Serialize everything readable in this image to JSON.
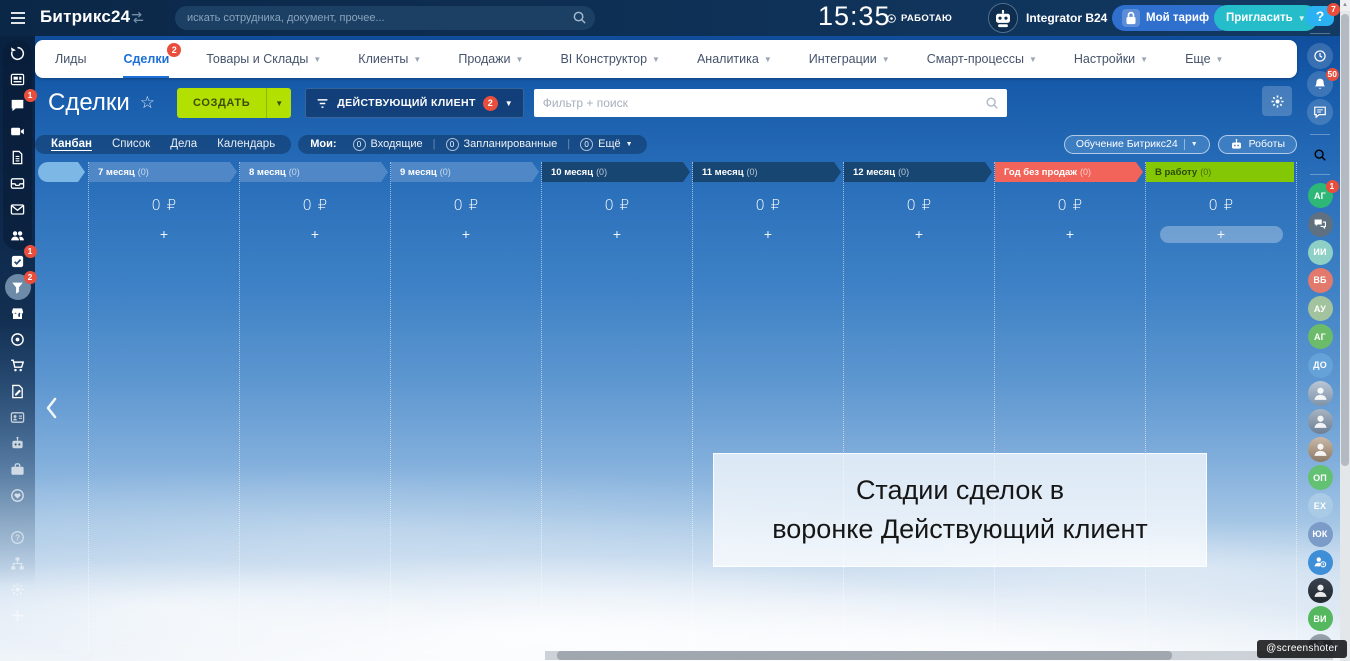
{
  "topbar": {
    "logo": "Битрикс24",
    "search_placeholder": "искать сотрудника, документ, прочее...",
    "time": "15:35",
    "status": "РАБОТАЮ",
    "user_name": "Integrator B24",
    "tariff_label": "Мой тариф",
    "invite_label": "Пригласить"
  },
  "nav": {
    "items": [
      {
        "id": "leads",
        "label": "Лиды"
      },
      {
        "id": "deals",
        "label": "Сделки",
        "badge": "2",
        "active": true
      },
      {
        "id": "products",
        "label": "Товары и Склады",
        "chevron": true
      },
      {
        "id": "clients",
        "label": "Клиенты",
        "chevron": true
      },
      {
        "id": "sales",
        "label": "Продажи",
        "chevron": true
      },
      {
        "id": "bi-constructor",
        "label": "BI Конструктор",
        "chevron": true
      },
      {
        "id": "analytics",
        "label": "Аналитика",
        "chevron": true
      },
      {
        "id": "integrations",
        "label": "Интеграции",
        "chevron": true
      },
      {
        "id": "smart-processes",
        "label": "Смарт-процессы",
        "chevron": true
      },
      {
        "id": "settings",
        "label": "Настройки",
        "chevron": true
      },
      {
        "id": "more",
        "label": "Еще",
        "chevron": true
      }
    ]
  },
  "header": {
    "title": "Сделки",
    "star_icon": "star-outline",
    "create_label": "СОЗДАТЬ",
    "filter_label": "ДЕЙСТВУЮЩИЙ КЛИЕНТ",
    "filter_badge": "2",
    "search_placeholder": "Фильтр + поиск"
  },
  "tabs": {
    "views": [
      "Канбан",
      "Список",
      "Дела",
      "Календарь"
    ],
    "active_view": "Канбан",
    "my_label": "Мои:",
    "counters": [
      {
        "count": "0",
        "label": "Входящие"
      },
      {
        "count": "0",
        "label": "Запланированные"
      },
      {
        "count": "0",
        "label": "Ещё",
        "chevron": true
      }
    ],
    "training_label": "Обучение Битрикс24",
    "robots_label": "Роботы"
  },
  "kanban": {
    "columns": [
      {
        "name": "7 месяц",
        "count": "(0)",
        "sum": "0 ₽",
        "header_bg": "#4f87c7",
        "header_text": "#ffffff",
        "arrow": true
      },
      {
        "name": "8 месяц",
        "count": "(0)",
        "sum": "0 ₽",
        "header_bg": "#4f87c7",
        "header_text": "#ffffff",
        "arrow": true
      },
      {
        "name": "9 месяц",
        "count": "(0)",
        "sum": "0 ₽",
        "header_bg": "#4f87c7",
        "header_text": "#ffffff",
        "arrow": true
      },
      {
        "name": "10 месяц",
        "count": "(0)",
        "sum": "0 ₽",
        "header_bg": "#174672",
        "header_text": "#ffffff",
        "arrow": true
      },
      {
        "name": "11 месяц",
        "count": "(0)",
        "sum": "0 ₽",
        "header_bg": "#174672",
        "header_text": "#ffffff",
        "arrow": true
      },
      {
        "name": "12 месяц",
        "count": "(0)",
        "sum": "0 ₽",
        "header_bg": "#174672",
        "header_text": "#ffffff",
        "arrow": true
      },
      {
        "name": "Год без продаж",
        "count": "(0)",
        "sum": "0 ₽",
        "header_bg": "#f2635a",
        "header_text": "#ffffff",
        "arrow": true
      },
      {
        "name": "В работу",
        "count": "(0)",
        "sum": "0 ₽",
        "header_bg": "#84c705",
        "header_text": "#2c4a08",
        "arrow": false,
        "wide_add": true
      }
    ],
    "add_label": "+"
  },
  "annotation": {
    "line1": "Стадии сделок в",
    "line2": "воронке Действующий клиент"
  },
  "left_rail": {
    "items": [
      {
        "icon": "pulse"
      },
      {
        "icon": "feed"
      },
      {
        "icon": "messenger",
        "badge": "1"
      },
      {
        "icon": "video"
      },
      {
        "icon": "documents"
      },
      {
        "icon": "drive"
      },
      {
        "icon": "mail"
      },
      {
        "icon": "groups"
      },
      {
        "icon": "tasks",
        "badge": "1"
      },
      {
        "icon": "crm-funnel",
        "badge": "2",
        "active": true
      },
      {
        "icon": "market"
      },
      {
        "icon": "copilot"
      },
      {
        "icon": "cart"
      },
      {
        "icon": "sign"
      },
      {
        "icon": "id-card",
        "dim": true
      },
      {
        "icon": "automation",
        "dim": true
      },
      {
        "icon": "briefcase",
        "dim": true
      },
      {
        "icon": "sticker",
        "dim": true
      }
    ],
    "footer": [
      {
        "icon": "help",
        "faint": true
      },
      {
        "icon": "sitemap",
        "faint": true
      },
      {
        "icon": "settings",
        "faint": true
      },
      {
        "icon": "add",
        "faint": true
      }
    ]
  },
  "right_rail": {
    "help_badge": "7",
    "tools": [
      {
        "icon": "history"
      },
      {
        "icon": "bell",
        "badge": "50"
      },
      {
        "icon": "chat-lines"
      }
    ],
    "avatars": [
      {
        "type": "initials",
        "label": "АГ",
        "color": "#2eb877",
        "badge": "1"
      },
      {
        "type": "icon",
        "icon": "bubbles",
        "color": "#5f7080"
      },
      {
        "type": "initials",
        "label": "ИИ",
        "color": "#8ed0c5"
      },
      {
        "type": "initials",
        "label": "ВБ",
        "color": "#e2796d"
      },
      {
        "type": "initials",
        "label": "АУ",
        "color": "#a3c39e"
      },
      {
        "type": "initials",
        "label": "АГ",
        "color": "#6cbb6a"
      },
      {
        "type": "initials",
        "label": "ДО",
        "color": "#64a2d8"
      },
      {
        "type": "photo",
        "tone": "light"
      },
      {
        "type": "photo",
        "tone": "mid"
      },
      {
        "type": "photo",
        "tone": "sepia"
      },
      {
        "type": "initials",
        "label": "ОП",
        "color": "#63c173"
      },
      {
        "type": "initials",
        "label": "ЕХ",
        "color": "#a9cbe6"
      },
      {
        "type": "initials",
        "label": "ЮК",
        "color": "#7b9cc9"
      },
      {
        "type": "icon",
        "icon": "person-clock",
        "color": "#3f8fd8"
      },
      {
        "type": "photo",
        "tone": "dark"
      },
      {
        "type": "initials",
        "label": "ВИ",
        "color": "#55b85e"
      },
      {
        "type": "photo",
        "tone": "grey"
      }
    ]
  },
  "watermark": "@screenshoter",
  "colors": {
    "topbar_bg": "#0f3157",
    "accent_create": "#b2e000",
    "badge_red": "#e94e3c",
    "nav_active_blue": "#1e6fd6",
    "invite_teal": "#25bdc9",
    "tariff_blue": "#2f6fce",
    "help_blue": "#29b1f2",
    "column_light": "#4f87c7",
    "column_dark": "#174672",
    "column_red": "#f2635a",
    "column_green": "#84c705"
  }
}
